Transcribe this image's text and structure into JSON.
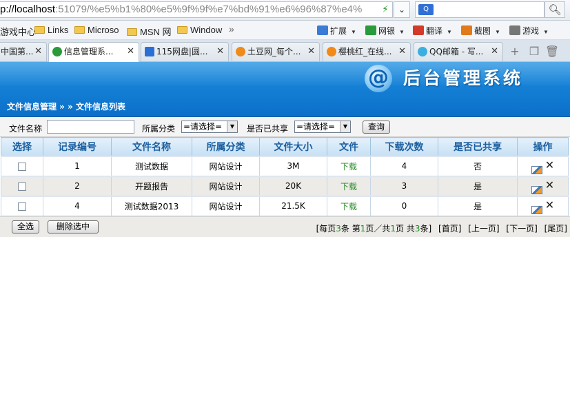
{
  "browser": {
    "url_host": "p://localhost",
    "url_rest": ":51079/%e5%b1%80%e5%9f%9f%e7%bd%91%e6%96%87%e4%",
    "search_placeholder": "",
    "favorites": [
      "游戏中心",
      "Links",
      "Microso",
      "MSN 网",
      "Window"
    ],
    "overflow": "»",
    "tools": [
      {
        "label": "扩展",
        "icon": "extensions-icon",
        "color": "#3a7bd5"
      },
      {
        "label": "网银",
        "icon": "bank-shield-icon",
        "color": "#2a9a3a"
      },
      {
        "label": "翻译",
        "icon": "translate-icon",
        "color": "#d43a2a"
      },
      {
        "label": "截图",
        "icon": "screenshot-icon",
        "color": "#e07a1a"
      },
      {
        "label": "游戏",
        "icon": "gamepad-icon",
        "color": "#777777"
      }
    ],
    "tabs": [
      {
        "label": "中国第...",
        "active": false,
        "icon_color": "#c53a2a"
      },
      {
        "label": "信息管理系...",
        "active": true,
        "icon_color": "#2a9a3a"
      },
      {
        "label": "115网盘|圆...",
        "active": false,
        "icon_color": "#2a6fd6"
      },
      {
        "label": "土豆网_每个...",
        "active": false,
        "icon_color": "#f08a1a"
      },
      {
        "label": "樱桃红_在线...",
        "active": false,
        "icon_color": "#f08a1a"
      },
      {
        "label": "QQ邮箱 - 写...",
        "active": false,
        "icon_color": "#3ab0e0"
      }
    ],
    "tab_close": "✕"
  },
  "header": {
    "logo_glyph": "@",
    "system_title": "后台管理系统",
    "breadcrumb": "文件信息管理 » » 文件信息列表"
  },
  "filter": {
    "file_name_label": "文件名称",
    "file_name_value": "",
    "category_label": "所属分类",
    "category_value": "=请选择=",
    "shared_label": "是否已共享",
    "shared_value": "=请选择=",
    "query_button": "查询"
  },
  "table": {
    "columns": [
      "选择",
      "记录编号",
      "文件名称",
      "所属分类",
      "文件大小",
      "文件",
      "下载次数",
      "是否已共享",
      "操作"
    ],
    "rows": [
      {
        "id": "1",
        "name": "测试数据",
        "category": "网站设计",
        "size": "3M",
        "file": "下载",
        "downloads": "4",
        "shared": "否"
      },
      {
        "id": "2",
        "name": "开题报告",
        "category": "网站设计",
        "size": "20K",
        "file": "下载",
        "downloads": "3",
        "shared": "是"
      },
      {
        "id": "4",
        "name": "测试数据2013",
        "category": "网站设计",
        "size": "21.5K",
        "file": "下载",
        "downloads": "0",
        "shared": "是"
      }
    ]
  },
  "footer": {
    "select_all": "全选",
    "delete_selected": "删除选中",
    "pager": {
      "prefix": "[每页",
      "per_page": "3",
      "mid1": "条 第",
      "page": "1",
      "mid2": "页／共",
      "total_pages": "1",
      "mid3": "页 共",
      "total": "3",
      "suffix": "条]",
      "first": "[首页]",
      "prev": "[上一页]",
      "next": "[下一页]",
      "last": "[尾页]"
    }
  }
}
